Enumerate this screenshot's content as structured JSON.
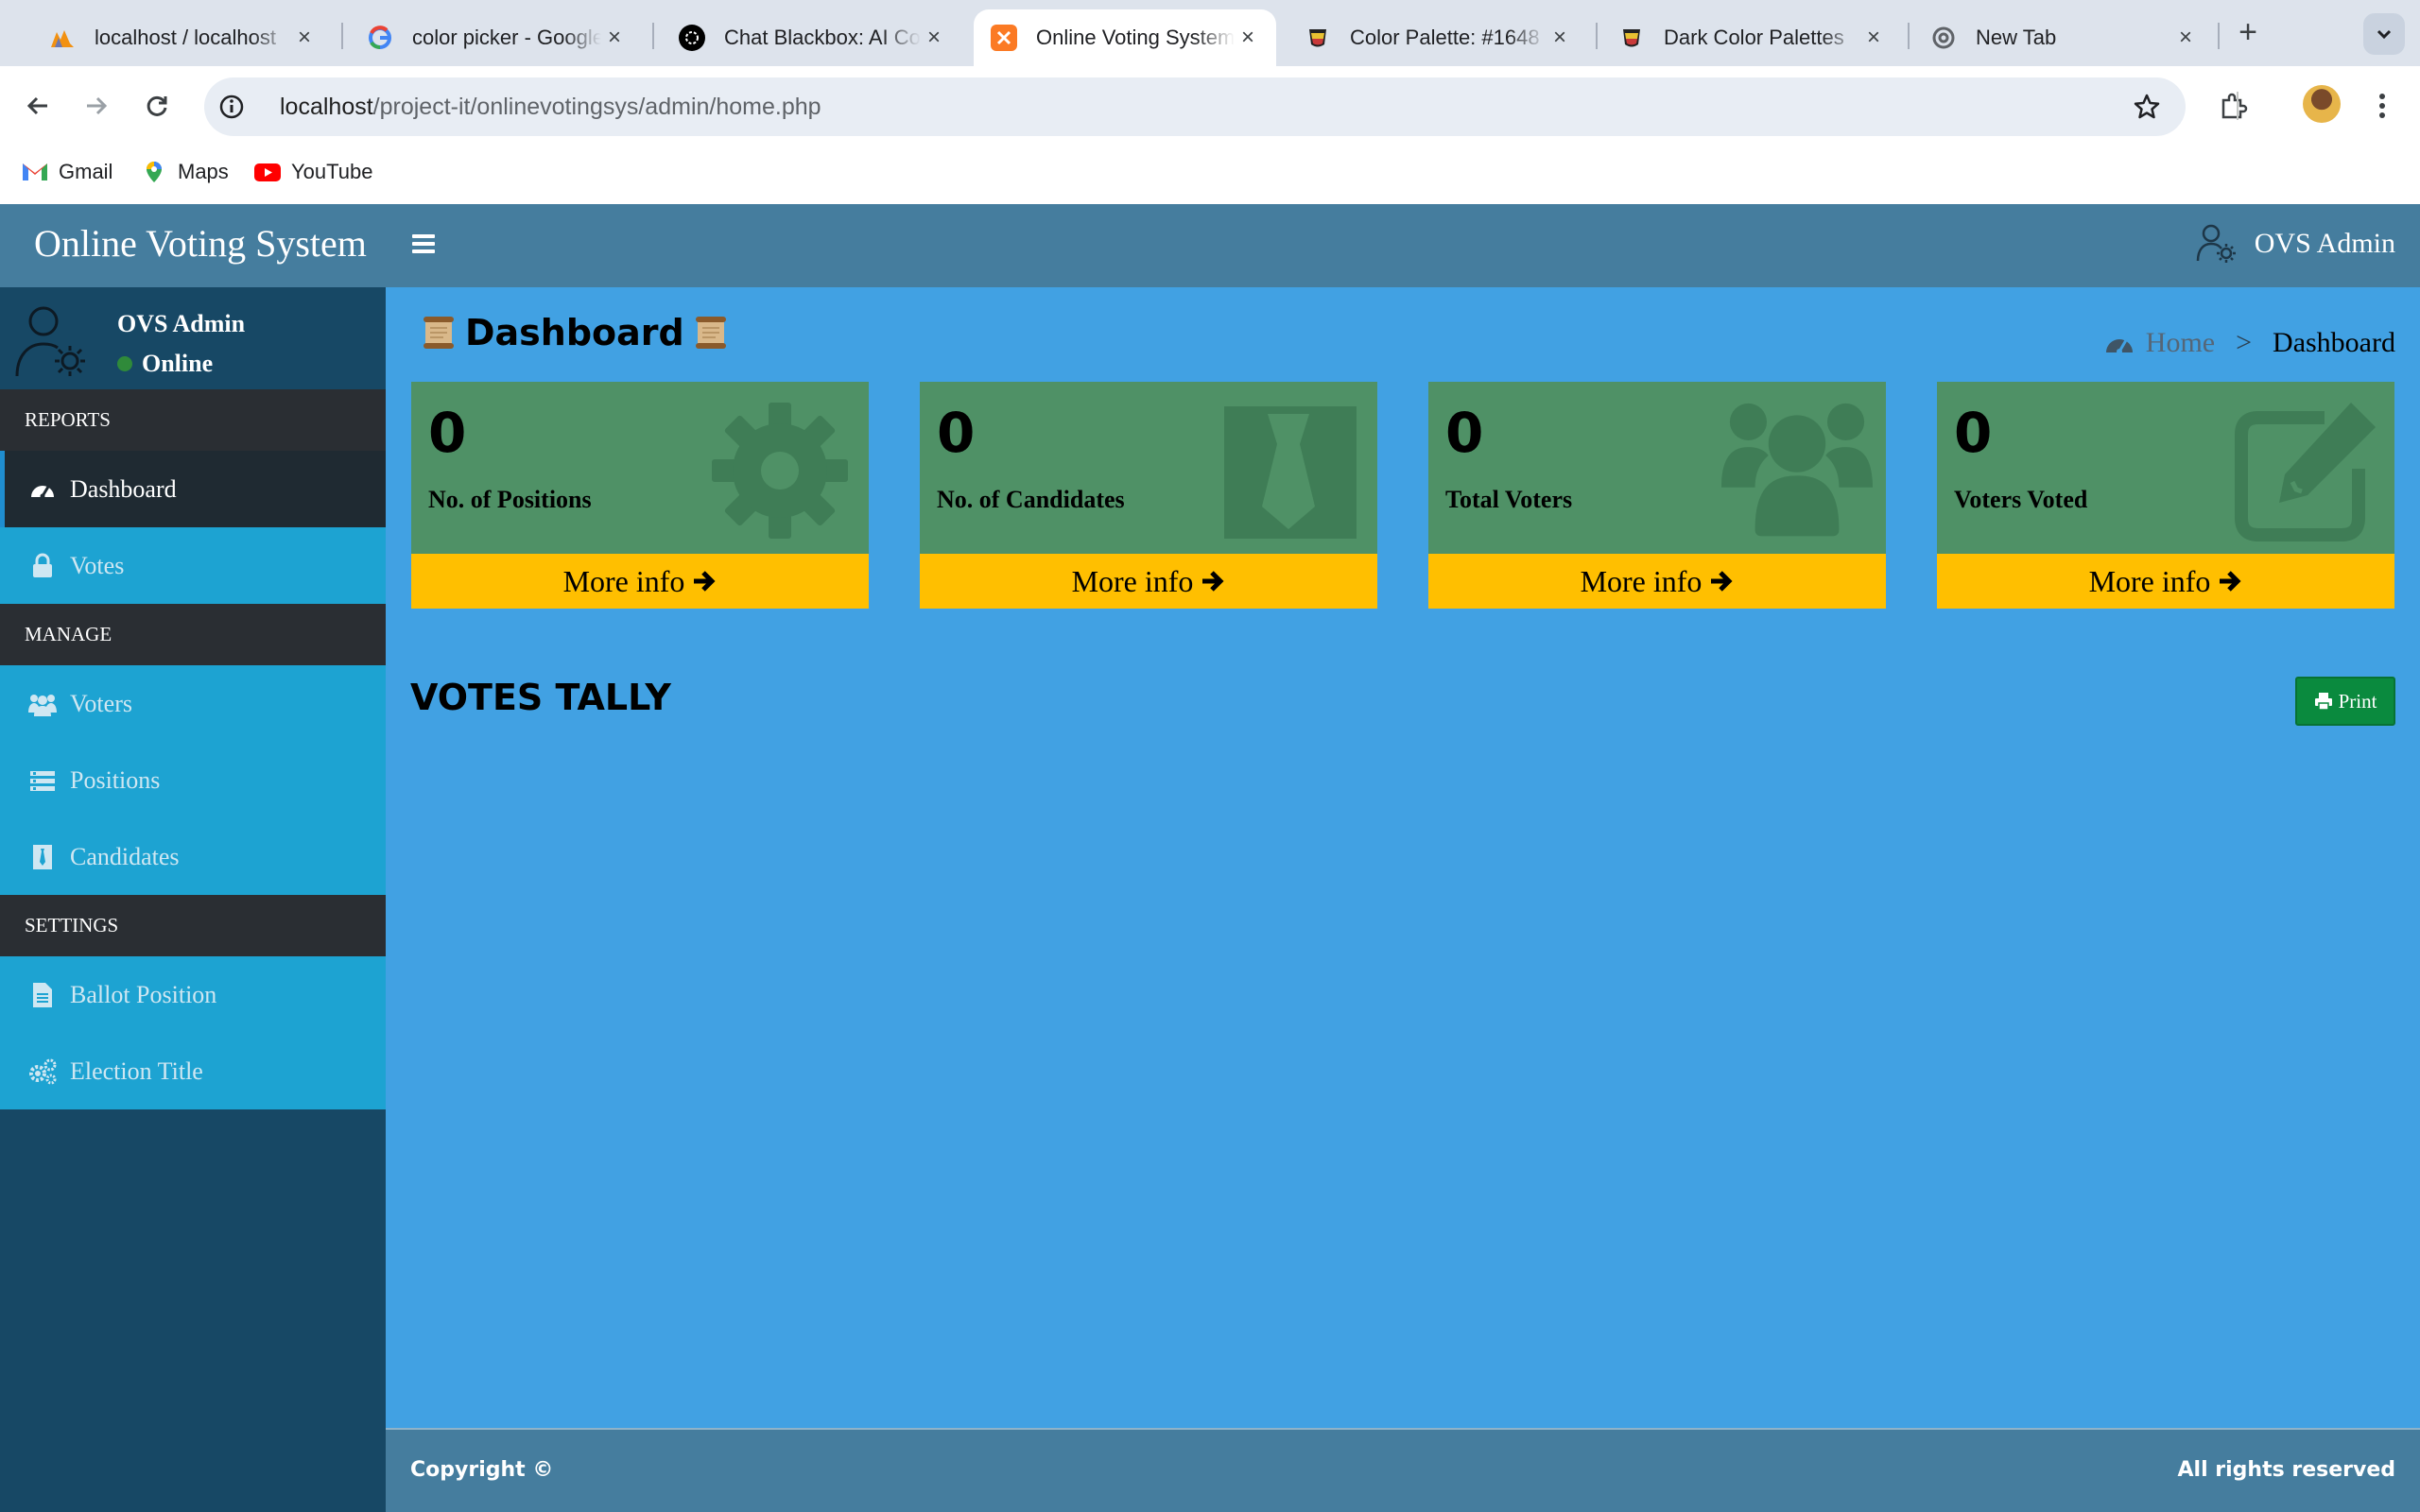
{
  "browser": {
    "tabs": [
      {
        "title": "localhost / localhost",
        "icon": "phpmyadmin-icon"
      },
      {
        "title": "color picker - Google Search",
        "icon": "google-icon"
      },
      {
        "title": "Chat Blackbox: AI Code",
        "icon": "blackbox-icon"
      },
      {
        "title": "Online Voting System",
        "icon": "xampp-icon",
        "active": true
      },
      {
        "title": "Color Palette: #1648",
        "icon": "palette-icon"
      },
      {
        "title": "Dark Color Palettes",
        "icon": "palette-icon"
      },
      {
        "title": "New Tab",
        "icon": "chrome-icon"
      }
    ],
    "url_host": "localhost",
    "url_path": "/project-it/onlinevotingsys/admin/home.php",
    "bookmarks": [
      {
        "label": "Gmail",
        "icon": "gmail-icon"
      },
      {
        "label": "Maps",
        "icon": "maps-icon"
      },
      {
        "label": "YouTube",
        "icon": "youtube-icon"
      }
    ]
  },
  "app": {
    "brand": "Online Voting System",
    "header_user": "OVS Admin",
    "user_panel": {
      "name": "OVS Admin",
      "status": "Online"
    },
    "nav": {
      "reports_header": "REPORTS",
      "dashboard": "Dashboard",
      "votes": "Votes",
      "manage_header": "MANAGE",
      "voters": "Voters",
      "positions": "Positions",
      "candidates": "Candidates",
      "settings_header": "SETTINGS",
      "ballot_position": "Ballot Position",
      "election_title": "Election Title"
    },
    "page_title": "Dashboard",
    "breadcrumb": {
      "home": "Home",
      "separator": ">",
      "current": "Dashboard"
    },
    "boxes": [
      {
        "count": "0",
        "label": "No. of Positions",
        "more": "More info",
        "icon": "gear-icon"
      },
      {
        "count": "0",
        "label": "No. of Candidates",
        "more": "More info",
        "icon": "tie-icon"
      },
      {
        "count": "0",
        "label": "Total Voters",
        "more": "More info",
        "icon": "users-icon"
      },
      {
        "count": "0",
        "label": "Voters Voted",
        "more": "More info",
        "icon": "edit-icon"
      }
    ],
    "tally_title": "VOTES TALLY",
    "print_label": "Print",
    "footer": {
      "copyright": "Copyright ©",
      "rights": "All rights reserved"
    }
  },
  "colors": {
    "header": "#457d9e",
    "sidebar": "#174865",
    "nav_item": "#1da3d2",
    "content": "#41a1e3",
    "box": "#4f9166",
    "box_footer": "#ffbf00",
    "print_button": "#0a8a3e"
  }
}
